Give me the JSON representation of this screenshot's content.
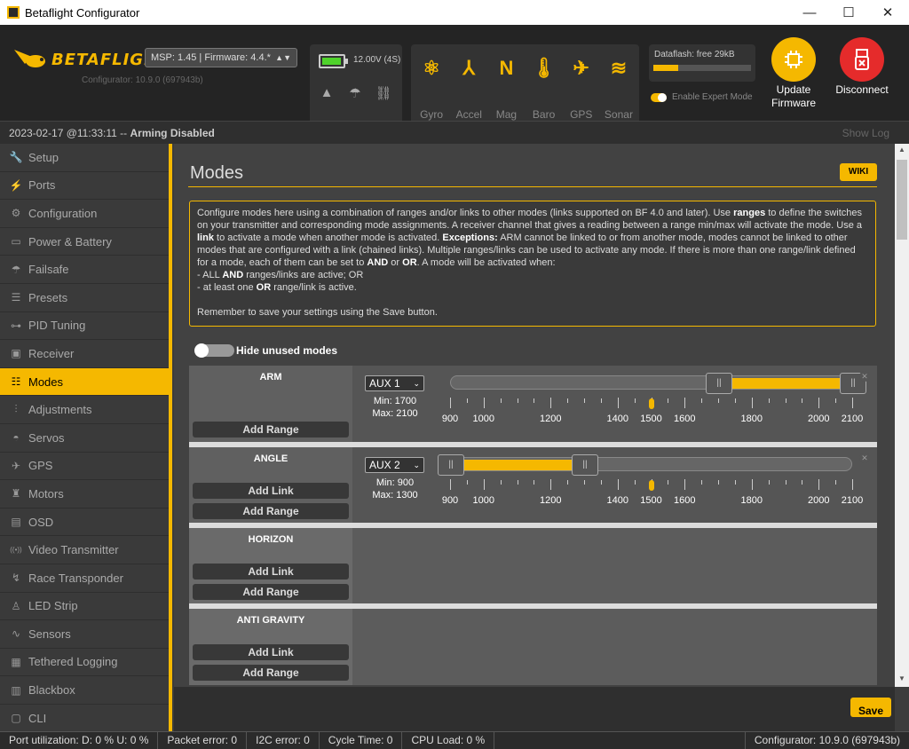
{
  "window": {
    "title": "Betaflight Configurator"
  },
  "header": {
    "logo_text": "BETAFLIGHT",
    "configurator_version": "Configurator: 10.9.0 (697943b)",
    "msp_select": "MSP: 1.45 | Firmware: 4.4.*",
    "battery": {
      "voltage": "12.00V (4S)",
      "level": 0.8,
      "color": "#4fd22b"
    },
    "sensors": [
      {
        "label": "Gyro",
        "icon": "gyro-icon",
        "glyph": "⚛"
      },
      {
        "label": "Accel",
        "icon": "accel-icon",
        "glyph": "⅄"
      },
      {
        "label": "Mag",
        "icon": "mag-icon",
        "glyph": "N"
      },
      {
        "label": "Baro",
        "icon": "baro-icon",
        "glyph": "🌡"
      },
      {
        "label": "GPS",
        "icon": "gps-icon",
        "glyph": "✈"
      },
      {
        "label": "Sonar",
        "icon": "sonar-icon",
        "glyph": "≋"
      }
    ],
    "dataflash": {
      "label": "Dataflash: free 29kB",
      "used_fraction": 0.25
    },
    "expert_mode": {
      "label": "Enable Expert Mode",
      "on": true
    },
    "update_firmware": {
      "line1": "Update",
      "line2": "Firmware"
    },
    "disconnect": {
      "label": "Disconnect"
    }
  },
  "status": {
    "datetime": "2023-02-17 @11:33:11",
    "separator": " -- ",
    "arming": "Arming Disabled",
    "show_log": "Show Log"
  },
  "sidebar": {
    "items": [
      {
        "label": "Setup",
        "icon": "wrench-icon",
        "glyph": "🔧"
      },
      {
        "label": "Ports",
        "icon": "plug-icon",
        "glyph": "⚡"
      },
      {
        "label": "Configuration",
        "icon": "gear-icon",
        "glyph": "⚙"
      },
      {
        "label": "Power & Battery",
        "icon": "battery-icon",
        "glyph": "▭"
      },
      {
        "label": "Failsafe",
        "icon": "parachute-icon",
        "glyph": "☂"
      },
      {
        "label": "Presets",
        "icon": "presets-icon",
        "glyph": "☰"
      },
      {
        "label": "PID Tuning",
        "icon": "pid-icon",
        "glyph": "⊶"
      },
      {
        "label": "Receiver",
        "icon": "receiver-icon",
        "glyph": "▣"
      },
      {
        "label": "Modes",
        "icon": "modes-icon",
        "glyph": "☷",
        "active": true
      },
      {
        "label": "Adjustments",
        "icon": "adjustments-icon",
        "glyph": "⫶"
      },
      {
        "label": "Servos",
        "icon": "servo-icon",
        "glyph": "◓"
      },
      {
        "label": "GPS",
        "icon": "satellite-icon",
        "glyph": "✈"
      },
      {
        "label": "Motors",
        "icon": "motor-icon",
        "glyph": "♜"
      },
      {
        "label": "OSD",
        "icon": "osd-icon",
        "glyph": "▤"
      },
      {
        "label": "Video Transmitter",
        "icon": "vtx-icon",
        "glyph": "((•))"
      },
      {
        "label": "Race Transponder",
        "icon": "transponder-icon",
        "glyph": "↯"
      },
      {
        "label": "LED Strip",
        "icon": "led-icon",
        "glyph": "♙"
      },
      {
        "label": "Sensors",
        "icon": "sensors-icon",
        "glyph": "∿"
      },
      {
        "label": "Tethered Logging",
        "icon": "logging-icon",
        "glyph": "▦"
      },
      {
        "label": "Blackbox",
        "icon": "blackbox-icon",
        "glyph": "▥"
      },
      {
        "label": "CLI",
        "icon": "cli-icon",
        "glyph": "▢"
      }
    ]
  },
  "modes": {
    "title": "Modes",
    "wiki": "WIKI",
    "info": {
      "p1": "Configure modes here using a combination of ranges and/or links to other modes (links supported on BF 4.0 and later). Use ",
      "b_ranges": "ranges",
      "p2": " to define the switches on your transmitter and corresponding mode assignments. A receiver channel that gives a reading between a range min/max will activate the mode. Use a ",
      "b_link": "link",
      "p3": " to activate a mode when another mode is activated. ",
      "b_exceptions": "Exceptions:",
      "p4": " ARM cannot be linked to or from another mode, modes cannot be linked to other modes that are configured with a link (chained links). Multiple ranges/links can be used to activate any mode. If there is more than one range/link defined for a mode, each of them can be set to ",
      "b_and": "AND",
      "p5": " or ",
      "b_or": "OR",
      "p6": ". A mode will be activated when:",
      "l1a": "- ALL ",
      "l1b": "AND",
      "l1c": " ranges/links are active; OR",
      "l2a": "- at least one ",
      "l2b": "OR",
      "l2c": " range/link is active.",
      "remember": "Remember to save your settings using the Save button."
    },
    "hide_unused_label": "Hide unused modes",
    "add_range_label": "Add Range",
    "add_link_label": "Add Link",
    "scale_ticks": [
      900,
      1000,
      1200,
      1400,
      1500,
      1600,
      1800,
      2000,
      2100
    ],
    "list": [
      {
        "name": "ARM",
        "channel": "AUX 1",
        "min_label": "Min: 1700",
        "max_label": "Max: 2100",
        "min": 1700,
        "max": 2100,
        "marker": 1500
      },
      {
        "name": "ANGLE",
        "channel": "AUX 2",
        "min_label": "Min: 900",
        "max_label": "Max: 1300",
        "min": 900,
        "max": 1300,
        "marker": 1500
      },
      {
        "name": "HORIZON"
      },
      {
        "name": "ANTI GRAVITY"
      }
    ]
  },
  "footer": {
    "save_label": "Save"
  },
  "bottombar": {
    "port_util": "Port utilization: D: 0 % U: 0 %",
    "packet_error": "Packet error: 0",
    "i2c_error": "I2C error: 0",
    "cycle_time": "Cycle Time: 0",
    "cpu_load": "CPU Load: 0 %",
    "configurator": "Configurator: 10.9.0 (697943b)"
  },
  "colors": {
    "accent": "#f5b800",
    "disconnect": "#e52b2b"
  }
}
